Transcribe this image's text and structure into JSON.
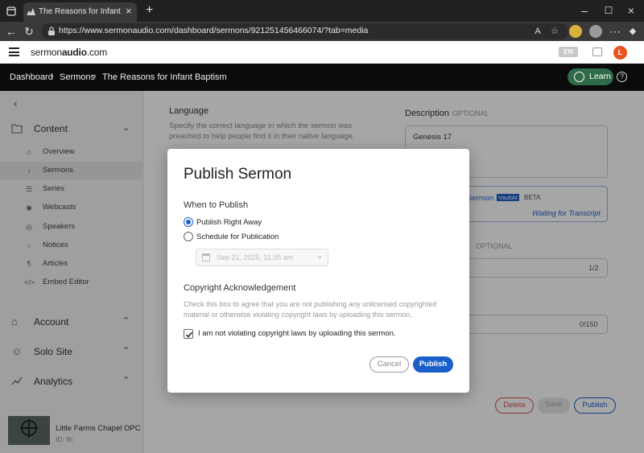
{
  "browser": {
    "tab_title": "The Reasons for Infant Baptism | S",
    "url": "https://www.sermonaudio.com/dashboard/sermons/921251456466074/?tab=media"
  },
  "app": {
    "logo_prefix": "sermon",
    "logo_bold": "audio",
    "logo_suffix": ".com",
    "lang": "EN",
    "avatar_letter": "L"
  },
  "breadcrumb": {
    "items": [
      "Dashboard",
      "Sermons",
      "The Reasons for Infant Baptism"
    ],
    "learn_label": "Learn"
  },
  "sidebar": {
    "content_label": "Content",
    "items": [
      {
        "label": "Overview",
        "icon": "home-icon"
      },
      {
        "label": "Sermons",
        "icon": "microphone-icon"
      },
      {
        "label": "Series",
        "icon": "list-icon"
      },
      {
        "label": "Webcasts",
        "icon": "broadcast-icon"
      },
      {
        "label": "Speakers",
        "icon": "speaker-icon"
      },
      {
        "label": "Notices",
        "icon": "chat-icon"
      },
      {
        "label": "Articles",
        "icon": "article-icon"
      },
      {
        "label": "Embed Editor",
        "icon": "code-icon"
      }
    ],
    "account_label": "Account",
    "solo_site_label": "Solo Site",
    "analytics_label": "Analytics",
    "channel_name": "Little Farms Chapel OPC",
    "channel_id": "ID: lfc"
  },
  "background_form": {
    "language_label": "Language",
    "language_hint": "Specify the correct language in which the sermon was preached to help people find it in their native language.",
    "description_label": "Description",
    "optional": "OPTIONAL",
    "description_value": "Genesis 17",
    "vault_label": "Sermon",
    "vault_badge": "VaultAI",
    "beta": "BETA",
    "waiting": "Waiting for Transcript",
    "counter1": "1/2",
    "counter2": "0/150",
    "delete_label": "Delete",
    "save_label": "Save",
    "publish_label": "Publish"
  },
  "modal": {
    "title": "Publish Sermon",
    "when_label": "When to Publish",
    "option_now": "Publish Right Away",
    "option_schedule": "Schedule for Publication",
    "selected": "now",
    "date_placeholder": "Sep 21, 2025, 11:35 am",
    "copyright_title": "Copyright Acknowledgement",
    "copyright_hint": "Check this box to agree that you are not publishing any unlicensed copyrighted material or otherwise violating copyright laws by uploading this sermon.",
    "checkbox_label": "I am not violating copyright laws by uploading this sermon.",
    "checkbox_checked": true,
    "cancel_label": "Cancel",
    "publish_label": "Publish"
  },
  "colors": {
    "primary": "#1a5fc9",
    "learn_green": "#2f6b48",
    "avatar_orange": "#e8541f",
    "delete_red": "#d9534f"
  }
}
